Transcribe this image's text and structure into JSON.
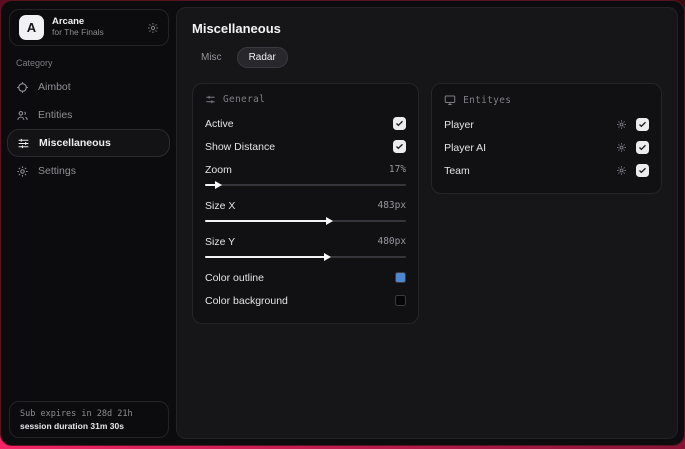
{
  "app": {
    "name": "Arcane",
    "subtitle": "for The Finals",
    "logo_letter": "A"
  },
  "sidebar": {
    "category_label": "Category",
    "items": [
      {
        "label": "Aimbot"
      },
      {
        "label": "Entities"
      },
      {
        "label": "Miscellaneous"
      },
      {
        "label": "Settings"
      }
    ],
    "footer": {
      "sub_expires": "Sub expires in 28d 21h",
      "session_duration": "session duration 31m 30s"
    }
  },
  "main": {
    "title": "Miscellaneous",
    "tabs": [
      {
        "label": "Misc"
      },
      {
        "label": "Radar"
      }
    ],
    "general_card": {
      "title": "General",
      "active": {
        "label": "Active",
        "checked": true
      },
      "show_distance": {
        "label": "Show Distance",
        "checked": true
      },
      "zoom": {
        "label": "Zoom",
        "value": "17%",
        "fill": "6%"
      },
      "size_x": {
        "label": "Size X",
        "value": "483px",
        "fill": "61%"
      },
      "size_y": {
        "label": "Size Y",
        "value": "480px",
        "fill": "60%"
      },
      "color_outline": {
        "label": "Color outline",
        "color": "#4e86d0"
      },
      "color_background": {
        "label": "Color background",
        "color": "#060608"
      }
    },
    "entities_card": {
      "title": "Entityes",
      "rows": [
        {
          "label": "Player",
          "checked": true
        },
        {
          "label": "Player AI",
          "checked": true
        },
        {
          "label": "Team",
          "checked": true
        }
      ]
    }
  }
}
